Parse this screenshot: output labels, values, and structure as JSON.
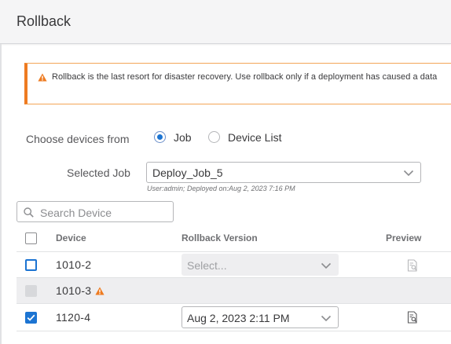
{
  "header": {
    "title": "Rollback"
  },
  "alert": {
    "message": "Rollback is the last resort for disaster recovery. Use rollback only if a deployment has caused a data"
  },
  "choose": {
    "label": "Choose devices from",
    "options": [
      {
        "label": "Job",
        "selected": true
      },
      {
        "label": "Device List",
        "selected": false
      }
    ]
  },
  "job": {
    "label": "Selected Job",
    "value": "Deploy_Job_5",
    "meta": "User:admin;  Deployed on:Aug 2, 2023 7:16 PM"
  },
  "search": {
    "placeholder": "Search Device"
  },
  "table": {
    "columns": {
      "device": "Device",
      "version": "Rollback Version",
      "preview": "Preview"
    },
    "rows": [
      {
        "device": "1010-2",
        "version": "Select...",
        "checked": false,
        "disabled": false,
        "warning": false
      },
      {
        "device": "1010-3",
        "version": "",
        "checked": false,
        "disabled": true,
        "warning": true
      },
      {
        "device": "1120-4",
        "version": "Aug 2, 2023 2:11 PM",
        "checked": true,
        "disabled": false,
        "warning": false
      }
    ]
  },
  "colors": {
    "accent": "#1c74d2",
    "warning": "#ee7b21"
  },
  "icons": [
    "warning-icon",
    "search-icon",
    "chevron-down-icon",
    "preview-icon",
    "check-icon"
  ]
}
